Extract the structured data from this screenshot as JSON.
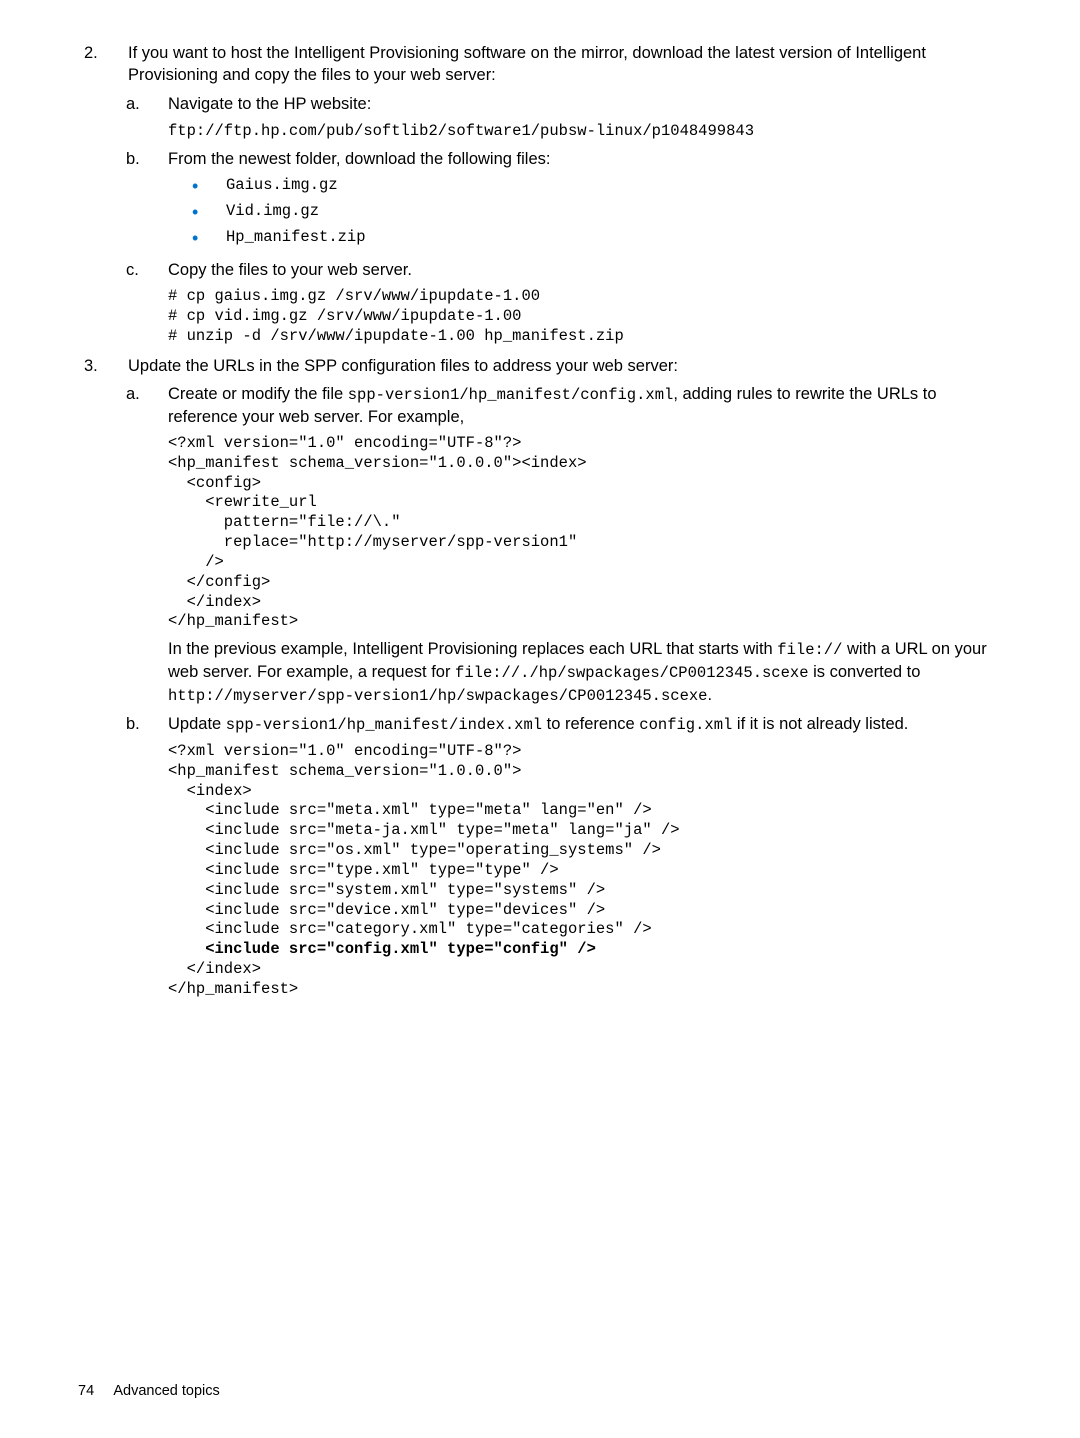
{
  "step2": {
    "num": "2.",
    "text": "If you want to host the Intelligent Provisioning software on the mirror, download the latest version of Intelligent Provisioning and copy the files to your web server:",
    "a": {
      "marker": "a.",
      "text": "Navigate to the HP website:",
      "url": "ftp://ftp.hp.com/pub/softlib2/software1/pubsw-linux/p1048499843"
    },
    "b": {
      "marker": "b.",
      "text": "From the newest folder, download the following files:",
      "files": [
        "Gaius.img.gz",
        "Vid.img.gz",
        "Hp_manifest.zip"
      ]
    },
    "c": {
      "marker": "c.",
      "text": "Copy the files to your web server.",
      "code": "# cp gaius.img.gz /srv/www/ipupdate-1.00\n# cp vid.img.gz /srv/www/ipupdate-1.00\n# unzip -d /srv/www/ipupdate-1.00 hp_manifest.zip"
    }
  },
  "step3": {
    "num": "3.",
    "text": "Update the URLs in the SPP configuration files to address your web server:",
    "a": {
      "marker": "a.",
      "pre": "Create or modify the file ",
      "code_inline": "spp-version1/hp_manifest/config.xml",
      "post": ", adding rules to rewrite the URLs to reference your web server. For example,",
      "codeblock": "<?xml version=\"1.0\" encoding=\"UTF-8\"?>\n<hp_manifest schema_version=\"1.0.0.0\"><index>\n  <config>\n    <rewrite_url\n      pattern=\"file://\\.\"\n      replace=\"http://myserver/spp-version1\"\n    />\n  </config>\n  </index>\n</hp_manifest>",
      "explain1a": "In the previous example, Intelligent Provisioning replaces each URL that starts with ",
      "explain1b": "file://",
      "explain1c": " with a URL on your web server. For example, a request for ",
      "explain1d": "file://./hp/swpackages/CP0012345.scexe",
      "explain1e": " is converted to ",
      "explain1f": "http://myserver/spp-version1/hp/swpackages/CP0012345.scexe",
      "explain1g": "."
    },
    "b": {
      "marker": "b.",
      "pre": "Update ",
      "code_inline1": "spp-version1/hp_manifest/index.xml",
      "mid": " to reference ",
      "code_inline2": "config.xml",
      "post": " if it is not already listed.",
      "codeblock_pre": "<?xml version=\"1.0\" encoding=\"UTF-8\"?>\n<hp_manifest schema_version=\"1.0.0.0\">\n  <index>\n    <include src=\"meta.xml\" type=\"meta\" lang=\"en\" />\n    <include src=\"meta-ja.xml\" type=\"meta\" lang=\"ja\" />\n    <include src=\"os.xml\" type=\"operating_systems\" />\n    <include src=\"type.xml\" type=\"type\" />\n    <include src=\"system.xml\" type=\"systems\" />\n    <include src=\"device.xml\" type=\"devices\" />\n    <include src=\"category.xml\" type=\"categories\" />",
      "codeblock_bold": "    <include src=\"config.xml\" type=\"config\" />",
      "codeblock_post": "  </index>\n</hp_manifest>"
    }
  },
  "footer": {
    "page": "74",
    "title": "Advanced topics"
  }
}
